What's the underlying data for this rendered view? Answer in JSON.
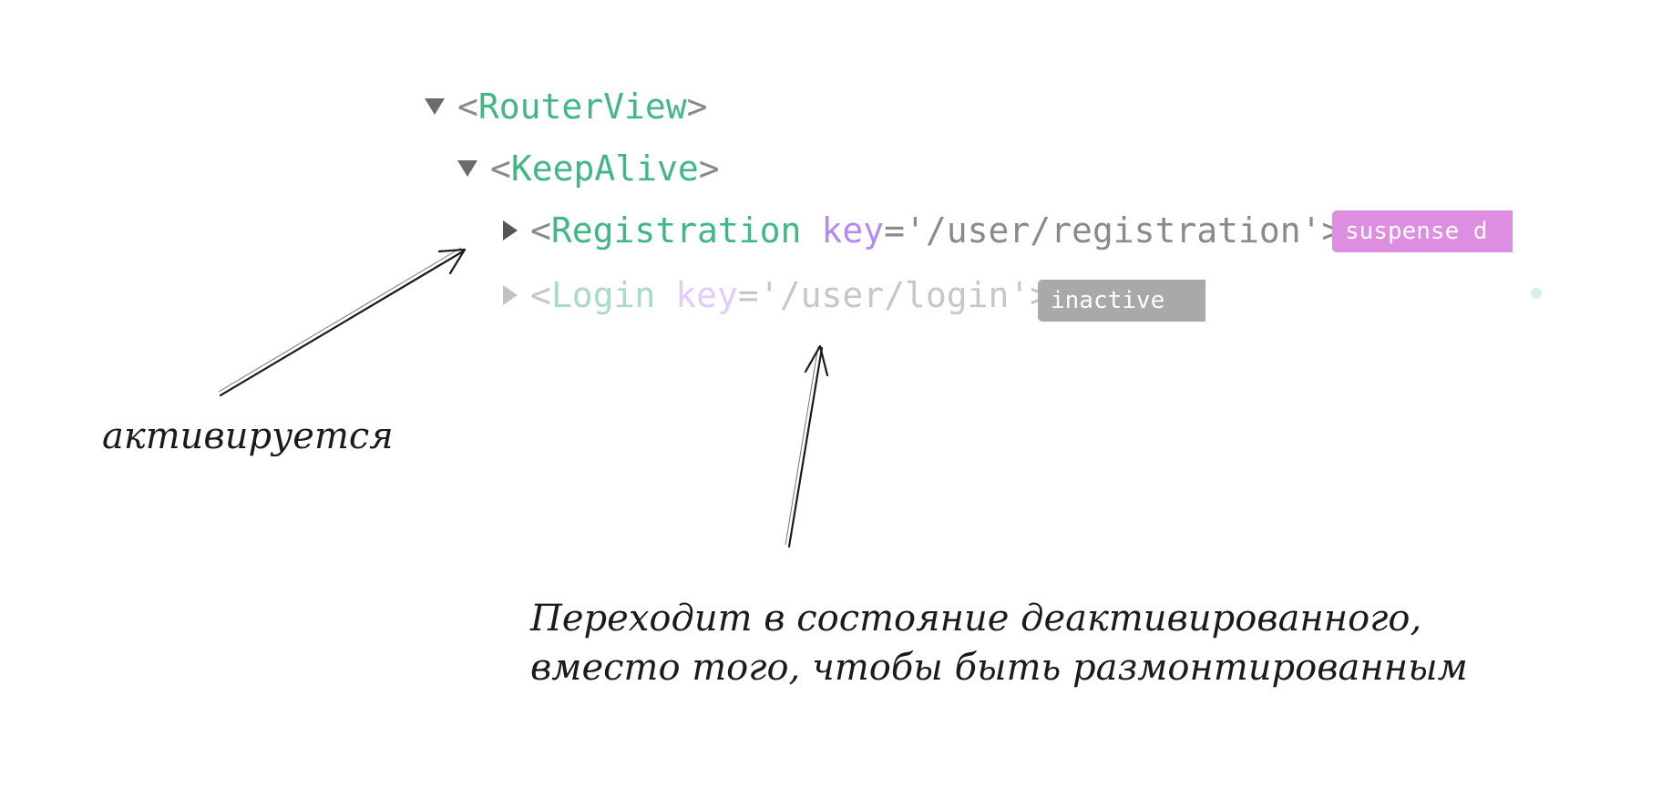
{
  "tree": {
    "router_view": {
      "open": "<",
      "name": "RouterView",
      "close": ">"
    },
    "keep_alive": {
      "open": "<",
      "name": "KeepAlive",
      "close": ">"
    },
    "registration": {
      "open": "<",
      "name": "Registration",
      "attr_name": "key",
      "equals": "=",
      "attr_value": "'/user/registration'",
      "close": ">",
      "badge": "suspense d"
    },
    "login": {
      "open": "<",
      "name": "Login",
      "attr_name": "key",
      "equals": "=",
      "attr_value": "'/user/login'",
      "close": ">",
      "badge": "inactive"
    }
  },
  "annotations": {
    "activates": "активируется",
    "deactivated_line1": "Переходит в состояние деактивированного,",
    "deactivated_line2": "вместо того, чтобы быть размонтированным"
  },
  "colors": {
    "tag": "#41b883",
    "attribute": "#b48cf0",
    "punctuation": "#8a8a8a",
    "badge_suspense": "#dd8ee0",
    "badge_inactive": "#a9a9a9",
    "ink": "#1b1b1b"
  },
  "icons": {
    "expanded": "triangle-down-icon",
    "collapsed": "triangle-right-icon"
  }
}
